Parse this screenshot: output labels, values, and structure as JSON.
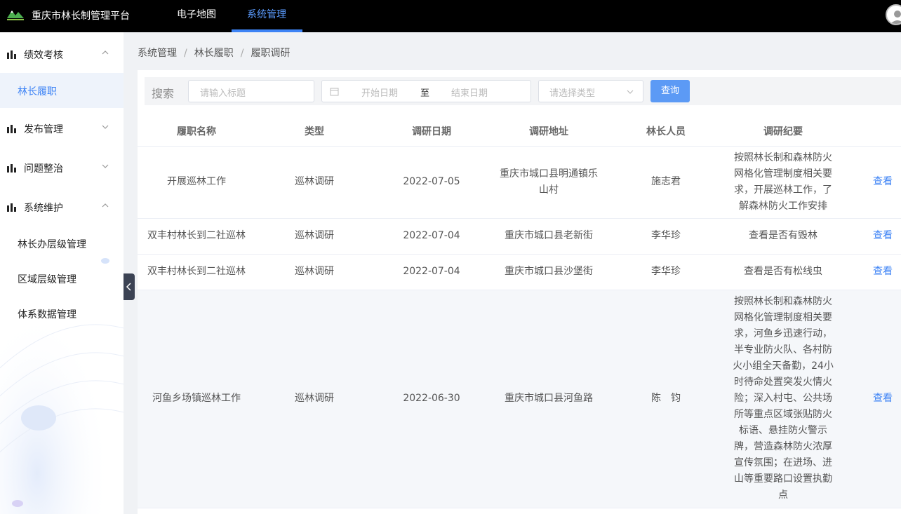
{
  "header": {
    "app_title": "重庆市林长制管理平台",
    "nav": [
      {
        "label": "电子地图",
        "active": false
      },
      {
        "label": "系统管理",
        "active": true
      }
    ],
    "accent_color": "#3d83f5"
  },
  "sidebar": {
    "groups": [
      {
        "label": "绩效考核",
        "expanded": true,
        "icon": "bar-chart-icon"
      },
      {
        "label": "发布管理",
        "expanded": false,
        "icon": "bar-chart-icon"
      },
      {
        "label": "问题整治",
        "expanded": false,
        "icon": "bar-chart-icon"
      },
      {
        "label": "系统维护",
        "expanded": true,
        "icon": "bar-chart-icon"
      }
    ],
    "items": [
      {
        "label": "林长履职",
        "active": true
      },
      {
        "label": "林长办层级管理",
        "active": false
      },
      {
        "label": "区域层级管理",
        "active": false
      },
      {
        "label": "体系数据管理",
        "active": false
      }
    ]
  },
  "breadcrumb": [
    "系统管理",
    "林长履职",
    "履职调研"
  ],
  "search": {
    "label": "搜索",
    "title_placeholder": "请输入标题",
    "start_placeholder": "开始日期",
    "range_sep": "至",
    "end_placeholder": "结束日期",
    "type_placeholder": "请选择类型",
    "query_button": "查询"
  },
  "table": {
    "columns": [
      "履职名称",
      "类型",
      "调研日期",
      "调研地址",
      "林长人员",
      "调研纪要"
    ],
    "rows": [
      {
        "name": "开展巡林工作",
        "type": "巡林调研",
        "date": "2022-07-05",
        "address": [
          "重庆市城口县明通镇乐",
          "山村"
        ],
        "person": "施志君",
        "summary": [
          "按照林长制和森林防火",
          "网格化管理制度相关要",
          "求，开展巡林工作，了",
          "解森林防火工作安排"
        ],
        "action": "查看"
      },
      {
        "name": "双丰村林长到二社巡林",
        "type": "巡林调研",
        "date": "2022-07-04",
        "address": [
          "重庆市城口县老新街"
        ],
        "person": "李华珍",
        "summary": [
          "查看是否有毁林"
        ],
        "action": "查看"
      },
      {
        "name": "双丰村林长到二社巡林",
        "type": "巡林调研",
        "date": "2022-07-04",
        "address": [
          "重庆市城口县沙堡街"
        ],
        "person": "李华珍",
        "summary": [
          "查看是否有松线虫"
        ],
        "action": "查看"
      },
      {
        "name": "河鱼乡场镇巡林工作",
        "type": "巡林调研",
        "date": "2022-06-30",
        "address": [
          "重庆市城口县河鱼路"
        ],
        "person": "陈　钧",
        "summary": [
          "按照林长制和森林防火",
          "网格化管理制度相关要",
          "求，河鱼乡迅速行动，",
          "半专业防火队、各村防",
          "火小组全天备勤，24小",
          "时待命处置突发火情火",
          "险；深入村屯、公共场",
          "所等重点区域张贴防火",
          "标语、悬挂防火警示",
          "牌，营造森林防火浓厚",
          "宣传氛围；在进场、进",
          "山等重要路口设置执勤",
          "点"
        ],
        "action": "查看"
      }
    ]
  }
}
